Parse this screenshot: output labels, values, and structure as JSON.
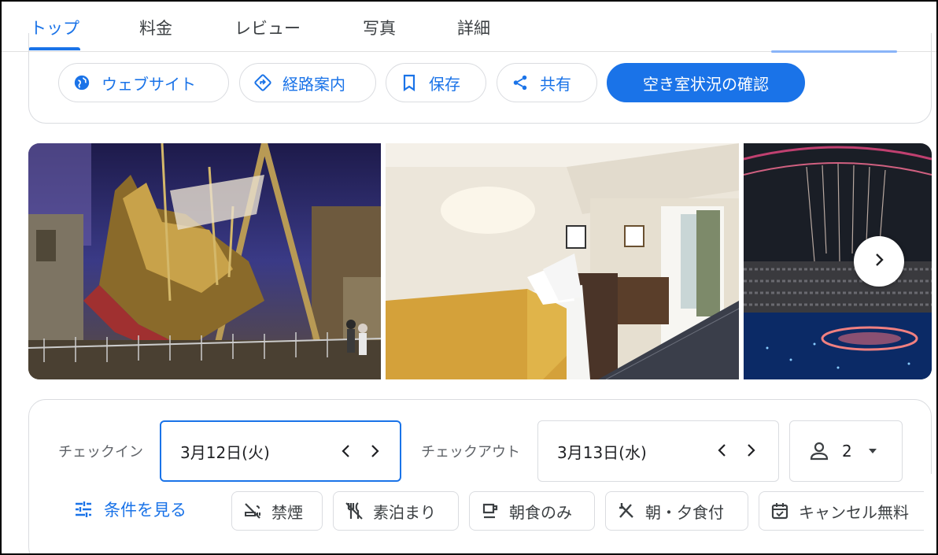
{
  "tabs": [
    {
      "label": "トップ"
    },
    {
      "label": "料金"
    },
    {
      "label": "レビュー"
    },
    {
      "label": "写真"
    },
    {
      "label": "詳細"
    }
  ],
  "actions": {
    "website": "ウェブサイト",
    "directions": "経路案内",
    "save": "保存",
    "share": "共有",
    "check_availability": "空き室状況の確認"
  },
  "booking": {
    "checkin_label": "チェックイン",
    "checkin_value": "3月12日(火)",
    "checkout_label": "チェックアウト",
    "checkout_value": "3月13日(水)",
    "guests": "2"
  },
  "filters": {
    "see_conditions": "条件を見る",
    "chips": [
      {
        "label": "禁煙",
        "icon": "no-smoking-icon"
      },
      {
        "label": "素泊まり",
        "icon": "no-meals-icon"
      },
      {
        "label": "朝食のみ",
        "icon": "coffee-cup-icon"
      },
      {
        "label": "朝・夕食付",
        "icon": "fork-knife-icon"
      },
      {
        "label": "キャンセル無料",
        "icon": "calendar-check-icon"
      }
    ]
  },
  "colors": {
    "accent": "#1a73e8",
    "border": "#dadce0",
    "text_secondary": "#5f6368"
  }
}
